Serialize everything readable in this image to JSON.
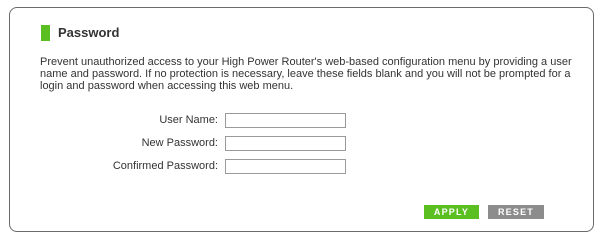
{
  "section": {
    "title": "Password",
    "accent_color": "#5bbf21"
  },
  "description": "Prevent unauthorized access to your High Power Router's web-based configuration menu by providing a user name and password. If no protection is necessary, leave these fields blank and you will not be prompted for a login and password when accessing this web menu.",
  "form": {
    "user_name_label": "User Name:",
    "user_name_value": "",
    "new_password_label": "New Password:",
    "new_password_value": "",
    "confirmed_password_label": "Confirmed Password:",
    "confirmed_password_value": ""
  },
  "buttons": {
    "apply_label": "APPLY",
    "apply_color": "#5bbf21",
    "reset_label": "RESET",
    "reset_color": "#8c8c8c"
  }
}
